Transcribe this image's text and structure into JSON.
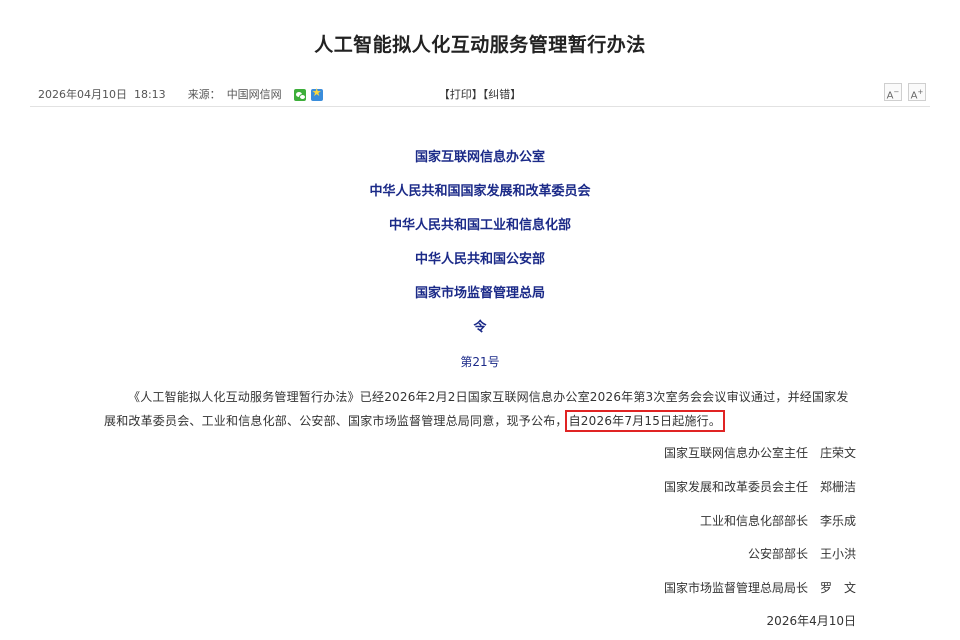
{
  "article": {
    "title": "人工智能拟人化互动服务管理暂行办法",
    "date_time": "2026年04月10日  18:13",
    "source_label": "来源：",
    "source_name": "中国网信网",
    "print_label": "【打印】",
    "correct_label": "【纠错】",
    "font_decrease": "A",
    "font_increase": "A"
  },
  "issuers": [
    "国家互联网信息办公室",
    "中华人民共和国国家发展和改革委员会",
    "中华人民共和国工业和信息化部",
    "中华人民共和国公安部",
    "国家市场监督管理总局"
  ],
  "order_title": "令",
  "order_number": "第21号",
  "body": {
    "text_before": "《人工智能拟人化互动服务管理暂行办法》已经2026年2月2日国家互联网信息办公室2026年第3次室务会会议审议通过，并经国家发展和改革委员会、工业和信息化部、公安部、国家市场监督管理总局同意，现予公布，",
    "highlighted": "自2026年7月15日起施行。"
  },
  "signatories": [
    {
      "title": "国家互联网信息办公室主任",
      "name": "庄荣文"
    },
    {
      "title": "国家发展和改革委员会主任",
      "name": "郑栅洁"
    },
    {
      "title": "工业和信息化部部长",
      "name": "李乐成"
    },
    {
      "title": "公安部部长",
      "name": "王小洪"
    },
    {
      "title": "国家市场监督管理总局局长",
      "name": "罗　文"
    }
  ],
  "sign_date": "2026年4月10日",
  "colors": {
    "issuer_blue": "#1b2a88",
    "highlight_red": "#e02424",
    "share_green": "#3dae3a",
    "share_blue": "#3a8ddb"
  },
  "icons": [
    "wechat-share-icon",
    "qzone-share-icon"
  ]
}
